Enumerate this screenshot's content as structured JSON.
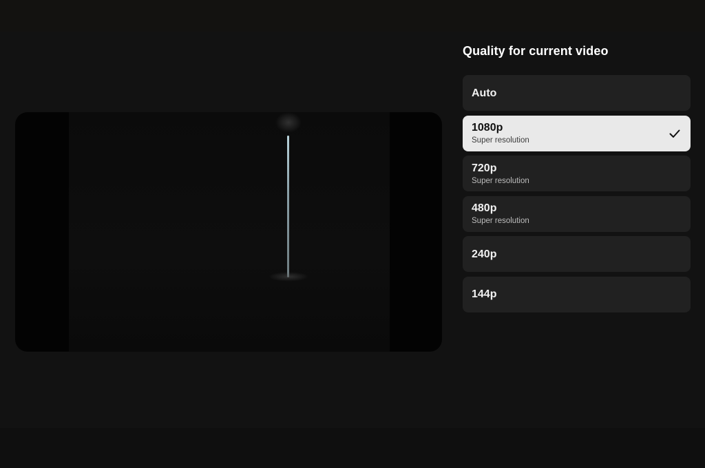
{
  "panel": {
    "title": "Quality for current video"
  },
  "options": [
    {
      "label": "Auto",
      "sublabel": ""
    },
    {
      "label": "1080p",
      "sublabel": "Super resolution",
      "selected": true
    },
    {
      "label": "720p",
      "sublabel": "Super resolution"
    },
    {
      "label": "480p",
      "sublabel": "Super resolution"
    },
    {
      "label": "240p",
      "sublabel": ""
    },
    {
      "label": "144p",
      "sublabel": ""
    }
  ],
  "icons": {
    "selected_indicator": "check-icon"
  },
  "colors": {
    "background": "#121212",
    "option_bg": "#212121",
    "option_selected_bg": "#e9e9e9"
  }
}
